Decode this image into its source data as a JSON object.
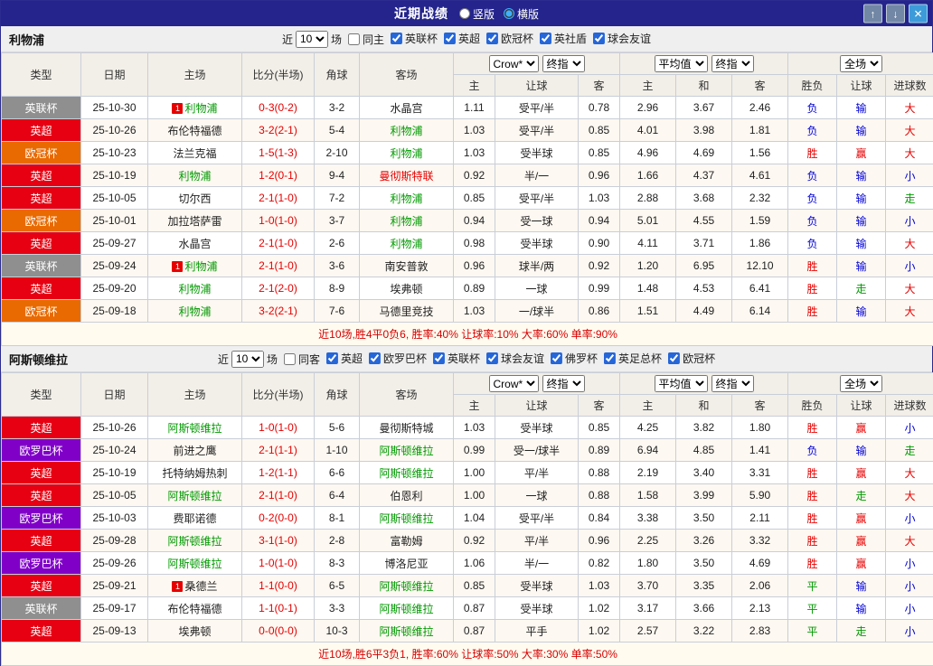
{
  "titlebar": {
    "title": "近期战绩",
    "layout_options": [
      {
        "label": "竖版",
        "selected": false
      },
      {
        "label": "横版",
        "selected": true
      }
    ],
    "window_buttons": [
      {
        "name": "up",
        "glyph": "↑"
      },
      {
        "name": "down",
        "glyph": "↓"
      },
      {
        "name": "close",
        "glyph": "✕"
      }
    ]
  },
  "labels": {
    "near": "近",
    "games": "场"
  },
  "dropdowns": {
    "asian_source": "Crow*",
    "asian_final": "终指",
    "euro_source": "平均值",
    "euro_final": "终指",
    "scope": "全场"
  },
  "table_columns": {
    "type": "类型",
    "date": "日期",
    "home": "主场",
    "score": "比分(半场)",
    "corner": "角球",
    "away": "客场",
    "asian_home": "主",
    "asian_handicap": "让球",
    "asian_away": "客",
    "euro_home": "主",
    "euro_draw": "和",
    "euro_away": "客",
    "result_winlose": "胜负",
    "result_handicap": "让球",
    "result_goals": "进球数"
  },
  "colors": {
    "win_red": "#e60000",
    "lose_blue": "#0000d8",
    "draw_green": "#009900",
    "focal_team_green": "#009900",
    "score_red": "#e60000",
    "summary_red": "#d60000",
    "epl_red": "#e60012",
    "ucl_orange": "#e96a00",
    "league_cup_gray": "#8f8f8f",
    "europa_purple": "#8000c8",
    "titlebar_bg": "#24248c"
  },
  "sections": [
    {
      "team": "利物浦",
      "filter": {
        "count": "10",
        "same_label": "同主",
        "same_checked": false,
        "leagues": [
          {
            "label": "英联杯",
            "checked": true
          },
          {
            "label": "英超",
            "checked": true
          },
          {
            "label": "欧冠杯",
            "checked": true
          },
          {
            "label": "英社盾",
            "checked": true
          },
          {
            "label": "球会友谊",
            "checked": true
          }
        ]
      },
      "rows": [
        {
          "league": "英联杯",
          "league_color": "#8f8f8f",
          "date": "25-10-30",
          "home": "利物浦",
          "home_focal": true,
          "home_badge": "1",
          "away": "水晶宫",
          "score": "0-3",
          "half": "(0-2)",
          "corner": "3-2",
          "a_home": "1.11",
          "handicap": "受平/半",
          "a_away": "0.78",
          "e_home": "2.96",
          "e_draw": "3.67",
          "e_away": "2.46",
          "wdl": "负",
          "wdl_c": "b",
          "ah": "输",
          "ah_c": "b",
          "ou": "大",
          "ou_c": "r"
        },
        {
          "league": "英超",
          "league_color": "#e60012",
          "date": "25-10-26",
          "home": "布伦特福德",
          "away": "利物浦",
          "away_focal": true,
          "score": "3-2",
          "half": "(2-1)",
          "corner": "5-4",
          "a_home": "1.03",
          "handicap": "受平/半",
          "a_away": "0.85",
          "e_home": "4.01",
          "e_draw": "3.98",
          "e_away": "1.81",
          "wdl": "负",
          "wdl_c": "b",
          "ah": "输",
          "ah_c": "b",
          "ou": "大",
          "ou_c": "r"
        },
        {
          "league": "欧冠杯",
          "league_color": "#e96a00",
          "date": "25-10-23",
          "home": "法兰克福",
          "away": "利物浦",
          "away_focal": true,
          "score": "1-5",
          "half": "(1-3)",
          "corner": "2-10",
          "a_home": "1.03",
          "handicap": "受半球",
          "a_away": "0.85",
          "e_home": "4.96",
          "e_draw": "4.69",
          "e_away": "1.56",
          "wdl": "胜",
          "wdl_c": "r",
          "ah": "赢",
          "ah_c": "r",
          "ou": "大",
          "ou_c": "r"
        },
        {
          "league": "英超",
          "league_color": "#e60012",
          "date": "25-10-19",
          "home": "利物浦",
          "home_focal": true,
          "away": "曼彻斯特联",
          "away_color": "#e60000",
          "score": "1-2",
          "half": "(0-1)",
          "corner": "9-4",
          "a_home": "0.92",
          "handicap": "半/一",
          "a_away": "0.96",
          "e_home": "1.66",
          "e_draw": "4.37",
          "e_away": "4.61",
          "wdl": "负",
          "wdl_c": "b",
          "ah": "输",
          "ah_c": "b",
          "ou": "小",
          "ou_c": "b"
        },
        {
          "league": "英超",
          "league_color": "#e60012",
          "date": "25-10-05",
          "home": "切尔西",
          "away": "利物浦",
          "away_focal": true,
          "score": "2-1",
          "half": "(1-0)",
          "corner": "7-2",
          "a_home": "0.85",
          "handicap": "受平/半",
          "a_away": "1.03",
          "e_home": "2.88",
          "e_draw": "3.68",
          "e_away": "2.32",
          "wdl": "负",
          "wdl_c": "b",
          "ah": "输",
          "ah_c": "b",
          "ou": "走",
          "ou_c": "g"
        },
        {
          "league": "欧冠杯",
          "league_color": "#e96a00",
          "date": "25-10-01",
          "home": "加拉塔萨雷",
          "away": "利物浦",
          "away_focal": true,
          "score": "1-0",
          "half": "(1-0)",
          "corner": "3-7",
          "a_home": "0.94",
          "handicap": "受一球",
          "a_away": "0.94",
          "e_home": "5.01",
          "e_draw": "4.55",
          "e_away": "1.59",
          "wdl": "负",
          "wdl_c": "b",
          "ah": "输",
          "ah_c": "b",
          "ou": "小",
          "ou_c": "b"
        },
        {
          "league": "英超",
          "league_color": "#e60012",
          "date": "25-09-27",
          "home": "水晶宫",
          "away": "利物浦",
          "away_focal": true,
          "score": "2-1",
          "half": "(1-0)",
          "corner": "2-6",
          "a_home": "0.98",
          "handicap": "受半球",
          "a_away": "0.90",
          "e_home": "4.11",
          "e_draw": "3.71",
          "e_away": "1.86",
          "wdl": "负",
          "wdl_c": "b",
          "ah": "输",
          "ah_c": "b",
          "ou": "大",
          "ou_c": "r"
        },
        {
          "league": "英联杯",
          "league_color": "#8f8f8f",
          "date": "25-09-24",
          "home": "利物浦",
          "home_focal": true,
          "home_badge": "1",
          "away": "南安普敦",
          "score": "2-1",
          "half": "(1-0)",
          "corner": "3-6",
          "a_home": "0.96",
          "handicap": "球半/两",
          "a_away": "0.92",
          "e_home": "1.20",
          "e_draw": "6.95",
          "e_away": "12.10",
          "wdl": "胜",
          "wdl_c": "r",
          "ah": "输",
          "ah_c": "b",
          "ou": "小",
          "ou_c": "b"
        },
        {
          "league": "英超",
          "league_color": "#e60012",
          "date": "25-09-20",
          "home": "利物浦",
          "home_focal": true,
          "away": "埃弗顿",
          "score": "2-1",
          "half": "(2-0)",
          "corner": "8-9",
          "a_home": "0.89",
          "handicap": "一球",
          "a_away": "0.99",
          "e_home": "1.48",
          "e_draw": "4.53",
          "e_away": "6.41",
          "wdl": "胜",
          "wdl_c": "r",
          "ah": "走",
          "ah_c": "g",
          "ou": "大",
          "ou_c": "r"
        },
        {
          "league": "欧冠杯",
          "league_color": "#e96a00",
          "date": "25-09-18",
          "home": "利物浦",
          "home_focal": true,
          "away": "马德里竞技",
          "score": "3-2",
          "half": "(2-1)",
          "corner": "7-6",
          "a_home": "1.03",
          "handicap": "一/球半",
          "a_away": "0.86",
          "e_home": "1.51",
          "e_draw": "4.49",
          "e_away": "6.14",
          "wdl": "胜",
          "wdl_c": "r",
          "ah": "输",
          "ah_c": "b",
          "ou": "大",
          "ou_c": "r"
        }
      ],
      "summary": "近10场,胜4平0负6, 胜率:40% 让球率:10% 大率:60% 单率:90%"
    },
    {
      "team": "阿斯顿维拉",
      "filter": {
        "count": "10",
        "same_label": "同客",
        "same_checked": false,
        "leagues": [
          {
            "label": "英超",
            "checked": true
          },
          {
            "label": "欧罗巴杯",
            "checked": true
          },
          {
            "label": "英联杯",
            "checked": true
          },
          {
            "label": "球会友谊",
            "checked": true
          },
          {
            "label": "佛罗杯",
            "checked": true
          },
          {
            "label": "英足总杯",
            "checked": true
          },
          {
            "label": "欧冠杯",
            "checked": true
          }
        ]
      },
      "rows": [
        {
          "league": "英超",
          "league_color": "#e60012",
          "date": "25-10-26",
          "home": "阿斯顿维拉",
          "home_focal": true,
          "away": "曼彻斯特城",
          "score": "1-0",
          "half": "(1-0)",
          "corner": "5-6",
          "a_home": "1.03",
          "handicap": "受半球",
          "a_away": "0.85",
          "e_home": "4.25",
          "e_draw": "3.82",
          "e_away": "1.80",
          "wdl": "胜",
          "wdl_c": "r",
          "ah": "赢",
          "ah_c": "r",
          "ou": "小",
          "ou_c": "b"
        },
        {
          "league": "欧罗巴杯",
          "league_color": "#8000c8",
          "date": "25-10-24",
          "home": "前进之鹰",
          "away": "阿斯顿维拉",
          "away_focal": true,
          "score": "2-1",
          "half": "(1-1)",
          "corner": "1-10",
          "a_home": "0.99",
          "handicap": "受一/球半",
          "a_away": "0.89",
          "e_home": "6.94",
          "e_draw": "4.85",
          "e_away": "1.41",
          "wdl": "负",
          "wdl_c": "b",
          "ah": "输",
          "ah_c": "b",
          "ou": "走",
          "ou_c": "g"
        },
        {
          "league": "英超",
          "league_color": "#e60012",
          "date": "25-10-19",
          "home": "托特纳姆热刺",
          "away": "阿斯顿维拉",
          "away_focal": true,
          "score": "1-2",
          "half": "(1-1)",
          "corner": "6-6",
          "a_home": "1.00",
          "handicap": "平/半",
          "a_away": "0.88",
          "e_home": "2.19",
          "e_draw": "3.40",
          "e_away": "3.31",
          "wdl": "胜",
          "wdl_c": "r",
          "ah": "赢",
          "ah_c": "r",
          "ou": "大",
          "ou_c": "r"
        },
        {
          "league": "英超",
          "league_color": "#e60012",
          "date": "25-10-05",
          "home": "阿斯顿维拉",
          "home_focal": true,
          "away": "伯恩利",
          "score": "2-1",
          "half": "(1-0)",
          "corner": "6-4",
          "a_home": "1.00",
          "handicap": "一球",
          "a_away": "0.88",
          "e_home": "1.58",
          "e_draw": "3.99",
          "e_away": "5.90",
          "wdl": "胜",
          "wdl_c": "r",
          "ah": "走",
          "ah_c": "g",
          "ou": "大",
          "ou_c": "r"
        },
        {
          "league": "欧罗巴杯",
          "league_color": "#8000c8",
          "date": "25-10-03",
          "home": "费耶诺德",
          "away": "阿斯顿维拉",
          "away_focal": true,
          "score": "0-2",
          "half": "(0-0)",
          "corner": "8-1",
          "a_home": "1.04",
          "handicap": "受平/半",
          "a_away": "0.84",
          "e_home": "3.38",
          "e_draw": "3.50",
          "e_away": "2.11",
          "wdl": "胜",
          "wdl_c": "r",
          "ah": "赢",
          "ah_c": "r",
          "ou": "小",
          "ou_c": "b"
        },
        {
          "league": "英超",
          "league_color": "#e60012",
          "date": "25-09-28",
          "home": "阿斯顿维拉",
          "home_focal": true,
          "away": "富勒姆",
          "score": "3-1",
          "half": "(1-0)",
          "corner": "2-8",
          "a_home": "0.92",
          "handicap": "平/半",
          "a_away": "0.96",
          "e_home": "2.25",
          "e_draw": "3.26",
          "e_away": "3.32",
          "wdl": "胜",
          "wdl_c": "r",
          "ah": "赢",
          "ah_c": "r",
          "ou": "大",
          "ou_c": "r"
        },
        {
          "league": "欧罗巴杯",
          "league_color": "#8000c8",
          "date": "25-09-26",
          "home": "阿斯顿维拉",
          "home_focal": true,
          "away": "博洛尼亚",
          "score": "1-0",
          "half": "(1-0)",
          "corner": "8-3",
          "a_home": "1.06",
          "handicap": "半/一",
          "a_away": "0.82",
          "e_home": "1.80",
          "e_draw": "3.50",
          "e_away": "4.69",
          "wdl": "胜",
          "wdl_c": "r",
          "ah": "赢",
          "ah_c": "r",
          "ou": "小",
          "ou_c": "b"
        },
        {
          "league": "英超",
          "league_color": "#e60012",
          "date": "25-09-21",
          "home": "桑德兰",
          "home_badge": "1",
          "away": "阿斯顿维拉",
          "away_focal": true,
          "score": "1-1",
          "half": "(0-0)",
          "corner": "6-5",
          "a_home": "0.85",
          "handicap": "受半球",
          "a_away": "1.03",
          "e_home": "3.70",
          "e_draw": "3.35",
          "e_away": "2.06",
          "wdl": "平",
          "wdl_c": "g",
          "ah": "输",
          "ah_c": "b",
          "ou": "小",
          "ou_c": "b"
        },
        {
          "league": "英联杯",
          "league_color": "#8f8f8f",
          "date": "25-09-17",
          "home": "布伦特福德",
          "away": "阿斯顿维拉",
          "away_focal": true,
          "score": "1-1",
          "half": "(0-1)",
          "corner": "3-3",
          "a_home": "0.87",
          "handicap": "受半球",
          "a_away": "1.02",
          "e_home": "3.17",
          "e_draw": "3.66",
          "e_away": "2.13",
          "wdl": "平",
          "wdl_c": "g",
          "ah": "输",
          "ah_c": "b",
          "ou": "小",
          "ou_c": "b"
        },
        {
          "league": "英超",
          "league_color": "#e60012",
          "date": "25-09-13",
          "home": "埃弗顿",
          "away": "阿斯顿维拉",
          "away_focal": true,
          "score": "0-0",
          "half": "(0-0)",
          "corner": "10-3",
          "a_home": "0.87",
          "handicap": "平手",
          "a_away": "1.02",
          "e_home": "2.57",
          "e_draw": "3.22",
          "e_away": "2.83",
          "wdl": "平",
          "wdl_c": "g",
          "ah": "走",
          "ah_c": "g",
          "ou": "小",
          "ou_c": "b"
        }
      ],
      "summary": "近10场,胜6平3负1, 胜率:60% 让球率:50% 大率:30% 单率:50%"
    }
  ]
}
